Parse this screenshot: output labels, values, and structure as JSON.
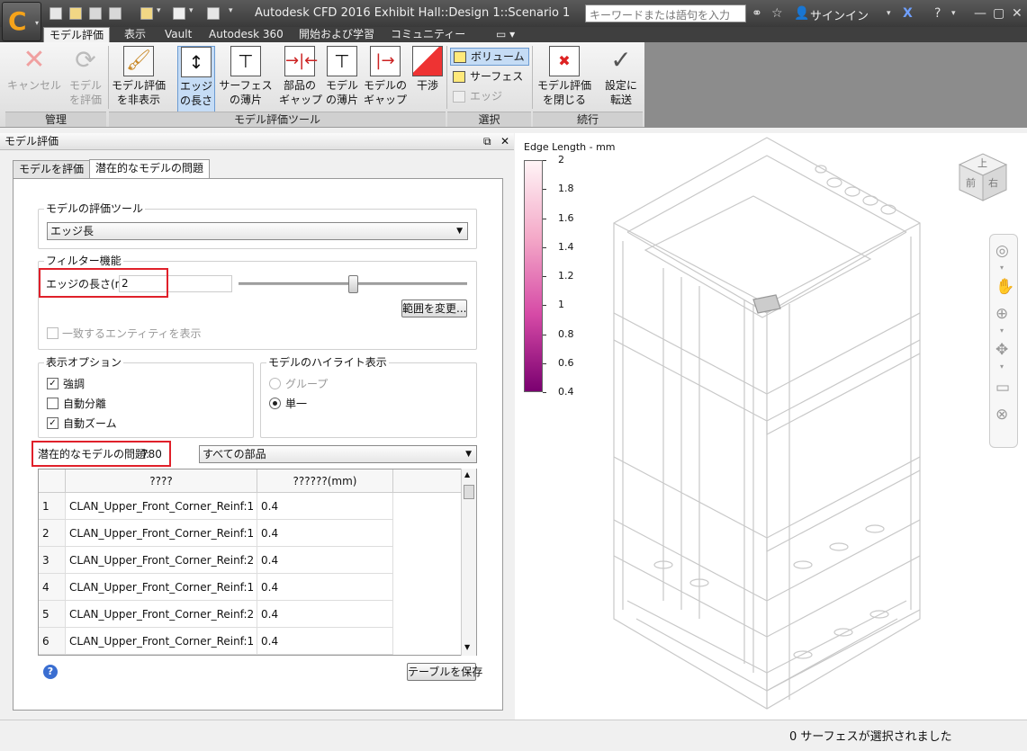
{
  "window": {
    "title": "Autodesk CFD 2016   Exhibit Hall::Design 1::Scenario 1",
    "search_placeholder": "キーワードまたは語句を入力",
    "signin_label": "サインイン"
  },
  "menu_tabs": [
    "モデル評価",
    "表示",
    "Vault",
    "Autodesk 360",
    "開始および学習",
    "コミュニティー"
  ],
  "ribbon": {
    "manage": {
      "label": "管理",
      "cancel": [
        "キャンセル",
        ""
      ],
      "eval": [
        "モデル",
        "を評価"
      ]
    },
    "tools": {
      "label": "モデル評価ツール",
      "hide": [
        "モデル評価",
        "を非表示"
      ],
      "edge": [
        "エッジ",
        "の長さ"
      ],
      "surface_thin": [
        "サーフェス",
        "の薄片"
      ],
      "part_gap": [
        "部品の",
        "ギャップ"
      ],
      "model_thin": [
        "モデル",
        "の薄片"
      ],
      "model_gap": [
        "モデルの",
        "ギャップ"
      ],
      "interference": [
        "干渉",
        ""
      ]
    },
    "selection": {
      "label": "選択",
      "volume": "ボリューム",
      "surface": "サーフェス",
      "edge": "エッジ"
    },
    "continue": {
      "label": "続行",
      "close": [
        "モデル評価",
        "を閉じる"
      ],
      "transfer": [
        "設定に",
        "転送"
      ]
    }
  },
  "panel": {
    "title": "モデル評価",
    "tabs": [
      "モデルを評価",
      "潜在的なモデルの問題"
    ],
    "eval_tool": {
      "group": "モデルの評価ツール",
      "selected": "エッジ長"
    },
    "filter": {
      "group": "フィルター機能",
      "edge_length_label": "エッジの長さ(mm)",
      "edge_length_value": "2",
      "slider_level": 0.5,
      "range_button": "範囲を変更...",
      "show_matching": "一致するエンティティを表示"
    },
    "display_options": {
      "group": "表示オプション",
      "items": [
        {
          "label": "強調",
          "checked": true
        },
        {
          "label": "自動分離",
          "checked": false
        },
        {
          "label": "自動ズーム",
          "checked": true
        }
      ]
    },
    "highlight": {
      "group": "モデルのハイライト表示",
      "group_option": "グループ",
      "single_option": "単一"
    },
    "issues": {
      "label": "潜在的なモデルの問題:",
      "count": "780",
      "filter": "すべての部品"
    },
    "table": {
      "columns": [
        "????",
        "??????(mm)"
      ],
      "rows": [
        [
          "1",
          "CLAN_Upper_Front_Corner_Reinf:1",
          "0.4"
        ],
        [
          "2",
          "CLAN_Upper_Front_Corner_Reinf:1",
          "0.4"
        ],
        [
          "3",
          "CLAN_Upper_Front_Corner_Reinf:2",
          "0.4"
        ],
        [
          "4",
          "CLAN_Upper_Front_Corner_Reinf:1",
          "0.4"
        ],
        [
          "5",
          "CLAN_Upper_Front_Corner_Reinf:2",
          "0.4"
        ],
        [
          "6",
          "CLAN_Upper_Front_Corner_Reinf:1",
          "0.4"
        ]
      ]
    },
    "save_table": "テーブルを保存"
  },
  "legend": {
    "title": "Edge Length - mm",
    "ticks": [
      "2",
      "1.8",
      "1.6",
      "1.4",
      "1.2",
      "1",
      "0.8",
      "0.6",
      "0.4"
    ],
    "color_top": "#fff4f6",
    "color_bottom": "#7a0070"
  },
  "viewcube": {
    "top": "上",
    "front": "前",
    "right": "右"
  },
  "status": "0 サーフェスが選択されました",
  "colors": {
    "accent": "#f5a31a",
    "highlight_box": "#e0202a",
    "selection": "#c5dcf5"
  }
}
